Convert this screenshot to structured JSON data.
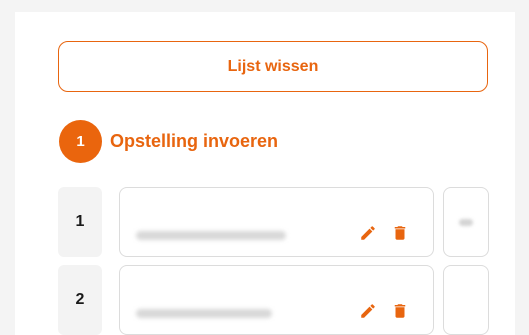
{
  "actions": {
    "clear_list_label": "Lijst wissen"
  },
  "step": {
    "number": "1",
    "title": "Opstelling invoeren"
  },
  "rows": [
    {
      "number": "1"
    },
    {
      "number": "2"
    }
  ],
  "colors": {
    "accent": "#e8650f"
  },
  "icons": {
    "edit": "pencil-icon",
    "delete": "trash-icon"
  }
}
